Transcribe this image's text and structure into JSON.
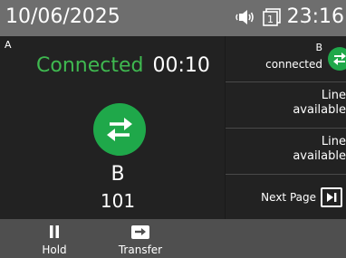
{
  "status_bar": {
    "date": "10/06/2025",
    "time": "23:16",
    "icons": [
      "speaker-icon",
      "line-page-icon"
    ],
    "line_page": "1"
  },
  "call": {
    "line_label": "A",
    "state": "Connected",
    "duration": "00:10",
    "caller_name": "B",
    "caller_number": "101",
    "state_color": "#3fb950",
    "icon_color": "#1fa84a"
  },
  "line_keys": [
    {
      "name": "B",
      "status": "connected",
      "icon": "transfer-arrows-icon"
    },
    {
      "label": "Line",
      "status": "available"
    },
    {
      "label": "Line",
      "status": "available"
    },
    {
      "label": "Next Page",
      "icon": "next-page-icon"
    }
  ],
  "softkeys": [
    {
      "label": "Hold",
      "icon": "pause-icon"
    },
    {
      "label": "Transfer",
      "icon": "transfer-icon"
    }
  ]
}
